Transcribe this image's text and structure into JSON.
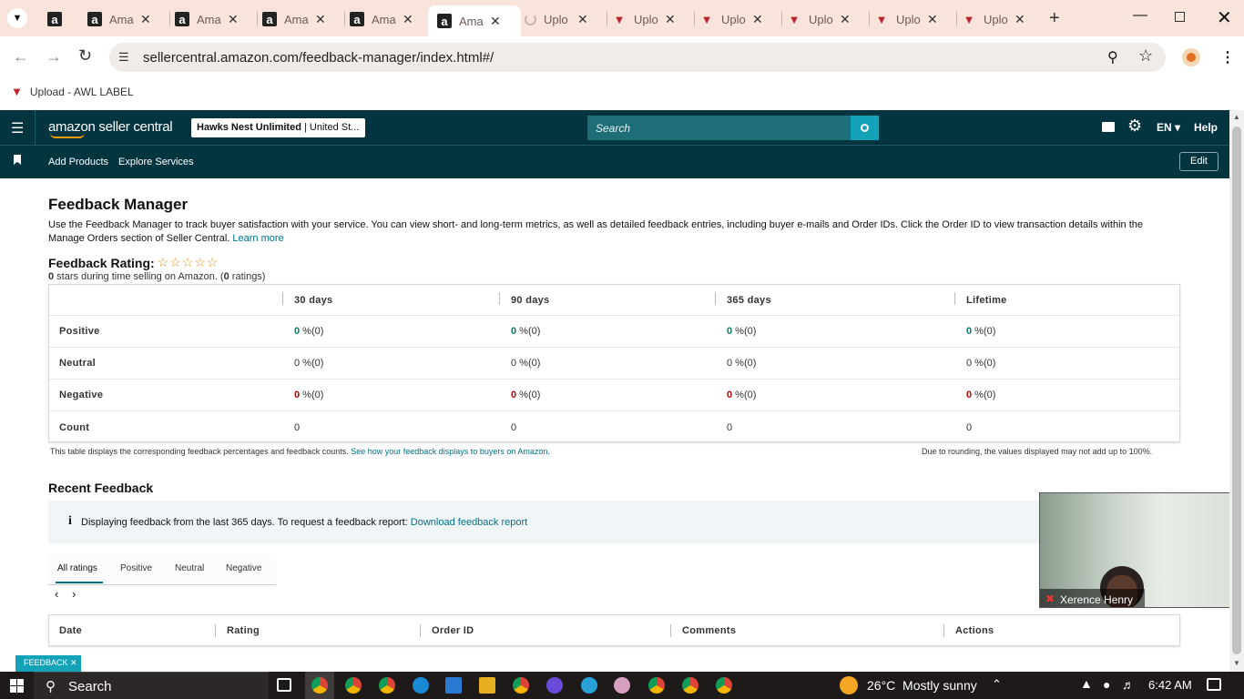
{
  "browser": {
    "tabs": [
      {
        "label": "",
        "favicon": "amazon"
      },
      {
        "label": "Ama",
        "favicon": "amazon"
      },
      {
        "label": "Ama",
        "favicon": "amazon"
      },
      {
        "label": "Ama",
        "favicon": "amazon"
      },
      {
        "label": "Ama",
        "favicon": "amazon"
      },
      {
        "label": "Ama",
        "favicon": "amazon",
        "active": true
      },
      {
        "label": "Uplo",
        "favicon": "loading"
      },
      {
        "label": "Uplo",
        "favicon": "awl"
      },
      {
        "label": "Uplo",
        "favicon": "awl"
      },
      {
        "label": "Uplo",
        "favicon": "awl"
      },
      {
        "label": "Uplo",
        "favicon": "awl"
      },
      {
        "label": "Uplo",
        "favicon": "awl"
      }
    ],
    "url": "sellercentral.amazon.com/feedback-manager/index.html#/",
    "bookmark": "Upload - AWL LABEL"
  },
  "header": {
    "logo": "amazon seller central",
    "store_bold": "Hawks Nest Unlimited",
    "store_rest": " | United St...",
    "search_placeholder": "Search",
    "lang": "EN",
    "help": "Help",
    "nav": [
      "Add Products",
      "Explore Services"
    ],
    "edit": "Edit"
  },
  "page": {
    "title": "Feedback Manager",
    "intro": "Use the Feedback Manager to track buyer satisfaction with your service. You can view short- and long-term metrics, as well as detailed feedback entries, including buyer e-mails and Order IDs. Click the Order ID to view transaction details within the Manage Orders section of Seller Central.",
    "learn_more": "Learn more",
    "rating_label": "Feedback Rating:",
    "stars_text_1": "0",
    "stars_text_2": " stars during time selling on Amazon. (",
    "stars_text_3": "0",
    "stars_text_4": " ratings)",
    "rating_value": 0
  },
  "ratings_table": {
    "columns": [
      "30 days",
      "90 days",
      "365 days",
      "Lifetime"
    ],
    "rows": [
      {
        "label": "Positive",
        "cells": [
          {
            "n": "0",
            "r": " %(0)"
          },
          {
            "n": "0",
            "r": " %(0)"
          },
          {
            "n": "0",
            "r": " %(0)"
          },
          {
            "n": "0",
            "r": " %(0)"
          }
        ],
        "color": "#067d62"
      },
      {
        "label": "Neutral",
        "cells": [
          {
            "n": "0",
            "r": " %(0)"
          },
          {
            "n": "0",
            "r": " %(0)"
          },
          {
            "n": "0",
            "r": " %(0)"
          },
          {
            "n": "0",
            "r": " %(0)"
          }
        ],
        "color": "#333333"
      },
      {
        "label": "Negative",
        "cells": [
          {
            "n": "0",
            "r": " %(0)"
          },
          {
            "n": "0",
            "r": " %(0)"
          },
          {
            "n": "0",
            "r": " %(0)"
          },
          {
            "n": "0",
            "r": " %(0)"
          }
        ],
        "color": "#c40000"
      },
      {
        "label": "Count",
        "cells": [
          {
            "n": "0",
            "r": ""
          },
          {
            "n": "0",
            "r": ""
          },
          {
            "n": "0",
            "r": ""
          },
          {
            "n": "0",
            "r": ""
          }
        ],
        "color": "#333333"
      }
    ],
    "footnote_left": "This table displays the corresponding feedback percentages and feedback counts.",
    "footnote_link": "See how your feedback displays to buyers on Amazon.",
    "footnote_right": "Due to rounding, the values displayed may not add up to 100%."
  },
  "recent": {
    "title": "Recent Feedback",
    "info": "Displaying feedback from the last 365 days. To request a feedback report:",
    "info_link": "Download feedback report",
    "filters": [
      "All ratings",
      "Positive",
      "Neutral",
      "Negative"
    ],
    "columns": [
      "Date",
      "Rating",
      "Order ID",
      "Comments",
      "Actions"
    ]
  },
  "feedback_tab": "FEEDBACK",
  "video": {
    "name": "Xerence Henry"
  },
  "taskbar": {
    "search": "Search",
    "weather": "26°C  Mostly sunny",
    "time": "6:42 AM"
  }
}
